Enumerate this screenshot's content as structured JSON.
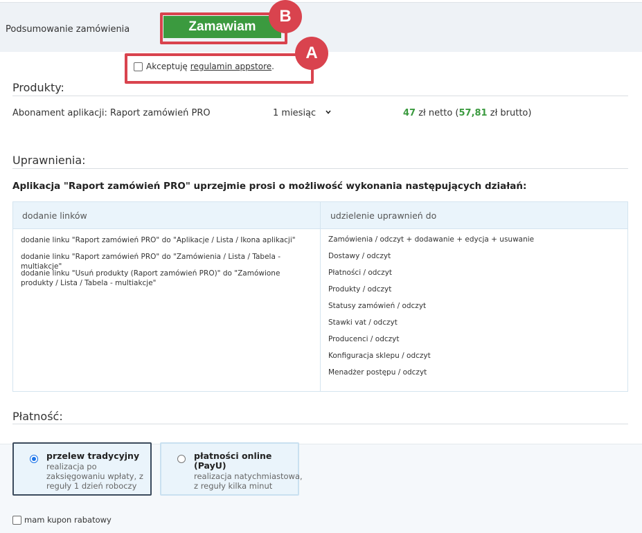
{
  "summary": {
    "title": "Podsumowanie zamówienia",
    "order_button": "Zamawiam",
    "marker_b": "B",
    "marker_a": "A",
    "accept_prefix": "Akceptuję",
    "accept_link": "regulamin appstore",
    "accept_suffix": "."
  },
  "products": {
    "section_title": "Produkty:",
    "name": "Abonament aplikacji: Raport zamówień PRO",
    "period": "1 miesiąc",
    "price_net": "47",
    "price_net_label": "zł netto (",
    "price_gross": "57,81",
    "price_gross_label": "zł brutto)"
  },
  "permissions": {
    "section_title": "Uprawnienia:",
    "intro": "Aplikacja \"Raport zamówień PRO\" uprzejmie prosi o możliwość wykonania następujących działań:",
    "col_links": "dodanie linków",
    "col_grants": "udzielenie uprawnień do",
    "links": [
      "dodanie linku \"Raport zamówień PRO\" do \"Aplikacje / Lista / Ikona aplikacji\"",
      "dodanie linku \"Raport zamówień PRO\" do \"Zamówienia / Lista / Tabela - multiakcje\"",
      "dodanie linku \"Usuń produkty (Raport zamówień PRO)\" do \"Zamówione produkty / Lista / Tabela - multiakcje\""
    ],
    "grants": [
      "Zamówienia / odczyt + dodawanie + edycja + usuwanie",
      "Dostawy / odczyt",
      "Płatności / odczyt",
      "Produkty / odczyt",
      "Statusy zamówień / odczyt",
      "Stawki vat / odczyt",
      "Producenci / odczyt",
      "Konfiguracja sklepu / odczyt",
      "Menadżer postępu / odczyt"
    ]
  },
  "payment": {
    "section_title": "Płatność:",
    "options": [
      {
        "title": "przelew tradycyjny",
        "desc": [
          "realizacja po",
          "zaksięgowaniu wpłaty, z",
          "reguły 1 dzień roboczy"
        ],
        "selected": true
      },
      {
        "title_line1": "płatności online",
        "title_line2": "(PayU)",
        "desc": [
          "realizacja natychmiastowa,",
          "z reguły kilka minut"
        ],
        "selected": false
      }
    ],
    "coupon_label": "mam kupon rabatowy"
  },
  "colors": {
    "accent_green": "#3b9a3f",
    "highlight_red": "#d9434e",
    "radio_blue": "#1a73e8"
  }
}
